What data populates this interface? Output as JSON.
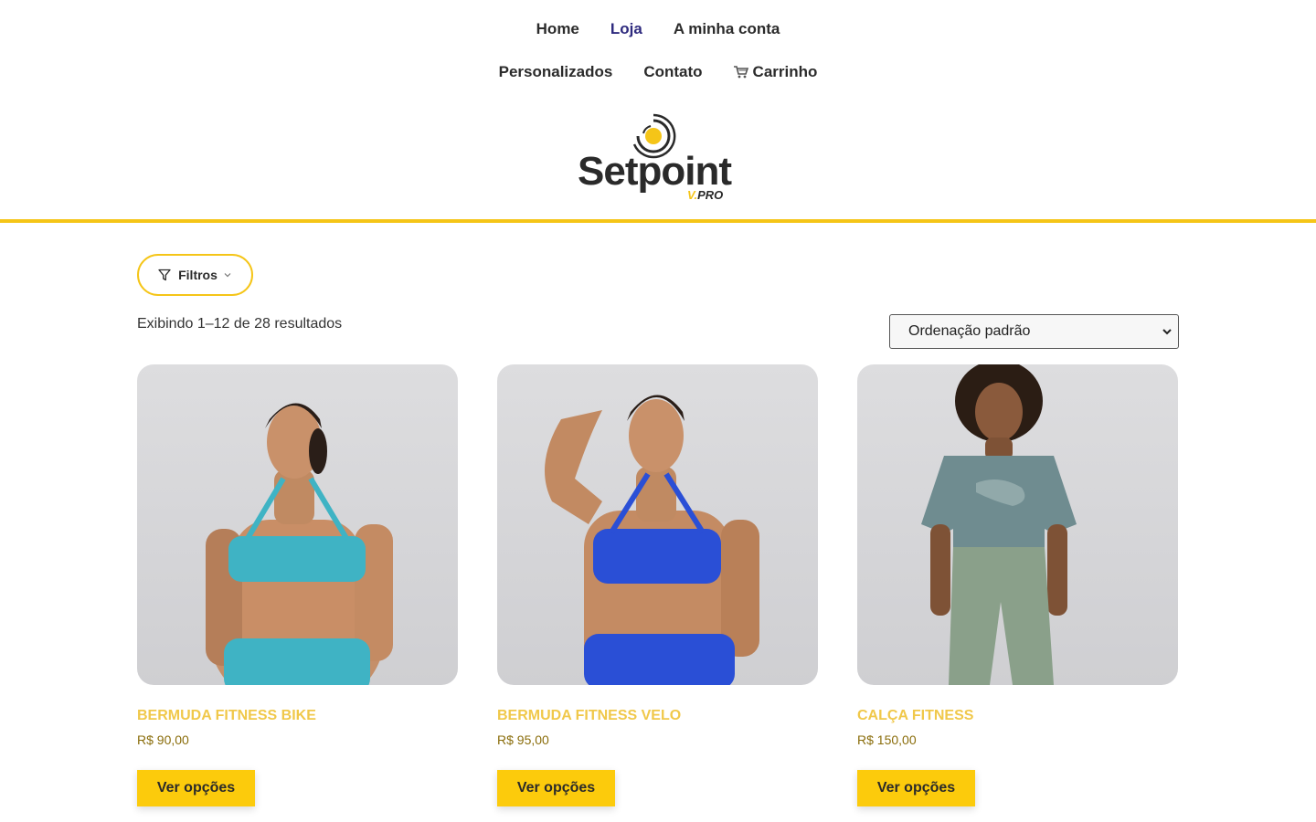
{
  "nav": {
    "home": "Home",
    "loja": "Loja",
    "conta": "A minha conta",
    "personalizados": "Personalizados",
    "contato": "Contato",
    "carrinho": "Carrinho"
  },
  "logo": {
    "text": "Setpoint",
    "sub_v": "V.",
    "sub_pro": "PRO"
  },
  "colors": {
    "accent": "#f5c518",
    "button": "#fccb0c",
    "active_nav": "#2e2a7e",
    "product_name": "#f0c84a",
    "price": "#8a6d0b"
  },
  "toolbar": {
    "filter_label": "Filtros",
    "result_count": "Exibindo 1–12 de 28 resultados",
    "orderby_selected": "Ordenação padrão"
  },
  "products": [
    {
      "name": "BERMUDA FITNESS BIKE",
      "price": "R$ 90,00",
      "button": "Ver opções",
      "outfit_color": "#3fb3c4"
    },
    {
      "name": "BERMUDA FITNESS VELO",
      "price": "R$ 95,00",
      "button": "Ver opções",
      "outfit_color": "#2a4fd6"
    },
    {
      "name": "CALÇA FITNESS",
      "price": "R$ 150,00",
      "button": "Ver opções",
      "outfit_color": "#8aa08a"
    }
  ],
  "icons": {
    "filter": "filter-funnel-icon",
    "dropdown": "chevron-down-icon",
    "cart": "cart-icon"
  }
}
